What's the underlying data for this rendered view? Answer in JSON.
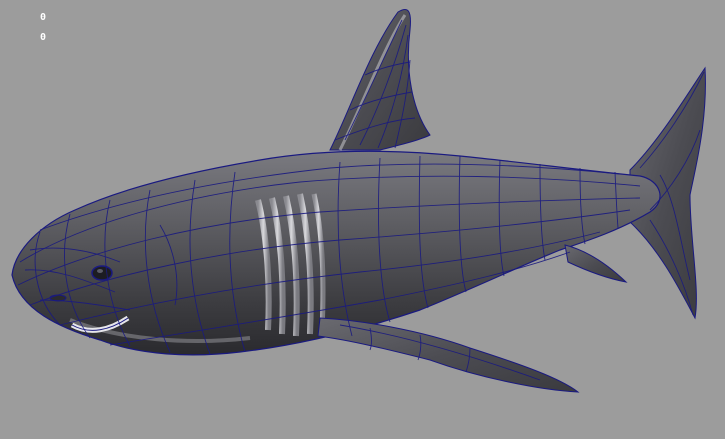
{
  "viewport": {
    "background_color": "#9c9c9c",
    "hud": {
      "line1": "0",
      "line2": "0"
    },
    "model": {
      "name_icon": "shark-mesh-icon",
      "surface_color": "#5c5c60",
      "highlight_color": "#d8d8dc",
      "wireframe_color": "#1a1a80"
    }
  }
}
